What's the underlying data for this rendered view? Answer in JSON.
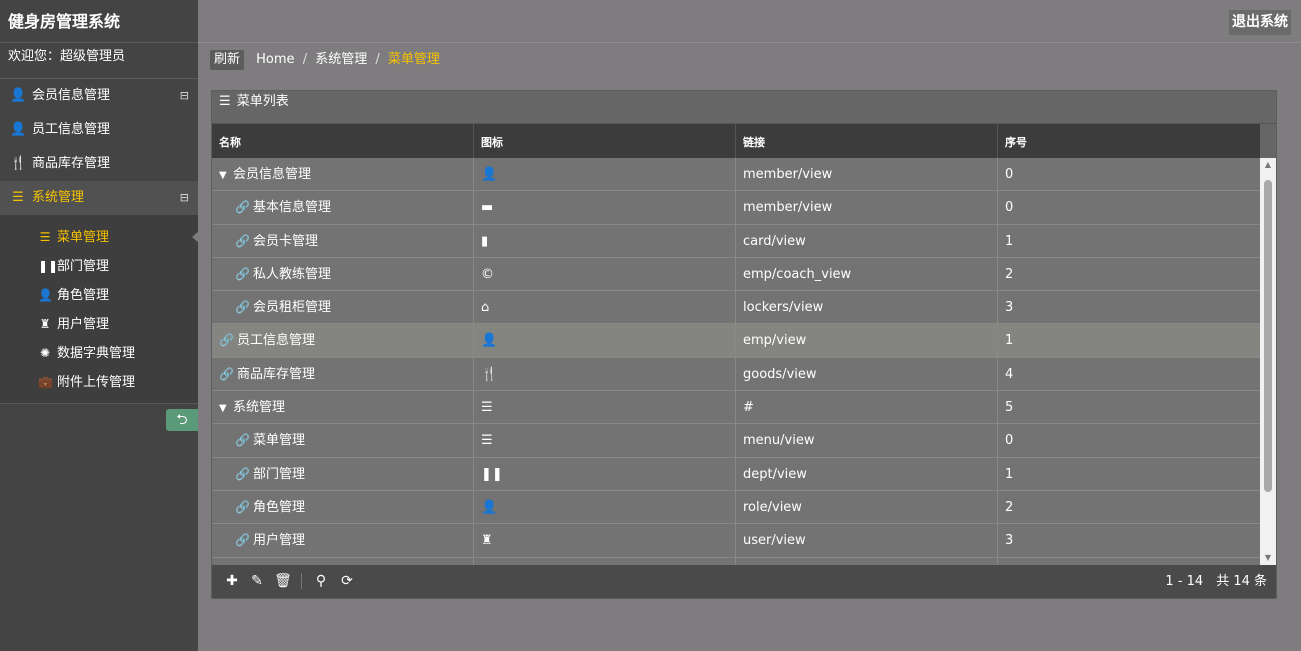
{
  "app": {
    "title": "健身房管理系统",
    "welcome": "欢迎您：超级管理员",
    "logout_label": "退出系统"
  },
  "sidebar": {
    "items": [
      {
        "label": "会员信息管理",
        "icon": "user-icon",
        "glyph": "👤",
        "toggle": "⊟"
      },
      {
        "label": "员工信息管理",
        "icon": "user-icon",
        "glyph": "👤"
      },
      {
        "label": "商品库存管理",
        "icon": "cutlery-icon",
        "glyph": "🍴"
      },
      {
        "label": "系统管理",
        "icon": "list-icon",
        "glyph": "☰",
        "toggle": "⊟"
      }
    ],
    "subitems": [
      {
        "label": "菜单管理",
        "icon": "list-icon",
        "glyph": "☰"
      },
      {
        "label": "部门管理",
        "icon": "pause-icon",
        "glyph": "❚❚"
      },
      {
        "label": "角色管理",
        "icon": "user-icon",
        "glyph": "👤"
      },
      {
        "label": "用户管理",
        "icon": "rook-icon",
        "glyph": "♜"
      },
      {
        "label": "数据字典管理",
        "icon": "gear-icon",
        "glyph": "✺"
      },
      {
        "label": "附件上传管理",
        "icon": "briefcase-icon",
        "glyph": "💼"
      }
    ],
    "collapse_glyph": "➔"
  },
  "breadcrumb": {
    "refresh": "刷新",
    "home": "Home",
    "parent": "系统管理",
    "current": "菜单管理",
    "sep": "/"
  },
  "panel": {
    "title": "菜单列表",
    "title_glyph": "☰",
    "columns": [
      "名称",
      "图标",
      "链接",
      "序号"
    ],
    "rows": [
      {
        "name": "会员信息管理",
        "level": 0,
        "kind": "folder",
        "icon": "user-icon",
        "glyph": "👤",
        "url": "member/view",
        "order": "0"
      },
      {
        "name": "基本信息管理",
        "level": 1,
        "kind": "leaf",
        "icon": "folder-icon",
        "glyph": "▬",
        "url": "member/view",
        "order": "0"
      },
      {
        "name": "会员卡管理",
        "level": 1,
        "kind": "leaf",
        "icon": "book-icon",
        "glyph": "▮",
        "url": "card/view",
        "order": "1"
      },
      {
        "name": "私人教练管理",
        "level": 1,
        "kind": "leaf",
        "icon": "copyright-icon",
        "glyph": "©",
        "url": "emp/coach_view",
        "order": "2"
      },
      {
        "name": "会员租柜管理",
        "level": 1,
        "kind": "leaf",
        "icon": "home-icon",
        "glyph": "⌂",
        "url": "lockers/view",
        "order": "3"
      },
      {
        "name": "员工信息管理",
        "level": 0,
        "kind": "leaf",
        "icon": "user-icon",
        "glyph": "👤",
        "url": "emp/view",
        "order": "1",
        "selected": true
      },
      {
        "name": "商品库存管理",
        "level": 0,
        "kind": "leaf",
        "icon": "cutlery-icon",
        "glyph": "🍴",
        "url": "goods/view",
        "order": "4"
      },
      {
        "name": "系统管理",
        "level": 0,
        "kind": "folder",
        "icon": "list-icon",
        "glyph": "☰",
        "url": "#",
        "order": "5"
      },
      {
        "name": "菜单管理",
        "level": 1,
        "kind": "leaf",
        "icon": "list-icon",
        "glyph": "☰",
        "url": "menu/view",
        "order": "0"
      },
      {
        "name": "部门管理",
        "level": 1,
        "kind": "leaf",
        "icon": "pause-icon",
        "glyph": "❚❚",
        "url": "dept/view",
        "order": "1"
      },
      {
        "name": "角色管理",
        "level": 1,
        "kind": "leaf",
        "icon": "user-icon",
        "glyph": "👤",
        "url": "role/view",
        "order": "2"
      },
      {
        "name": "用户管理",
        "level": 1,
        "kind": "leaf",
        "icon": "rook-icon",
        "glyph": "♜",
        "url": "user/view",
        "order": "3"
      },
      {
        "name": "",
        "level": 1,
        "kind": "leaf",
        "icon": "",
        "glyph": "",
        "url": "",
        "order": ""
      }
    ],
    "toolbar": [
      {
        "name": "add-icon",
        "glyph": "✚"
      },
      {
        "name": "edit-icon",
        "glyph": "✎"
      },
      {
        "name": "delete-icon",
        "glyph": "🗑"
      },
      {
        "name": "search-icon",
        "glyph": "⚲"
      },
      {
        "name": "refresh-icon",
        "glyph": "⟳"
      }
    ],
    "pager": "1 - 14　共 14 条"
  },
  "colors": {
    "accent": "#f6c200",
    "sidebar_bg": "#444444",
    "page_bg": "#7e7c7e",
    "collapse_btn": "#5a9a79"
  }
}
